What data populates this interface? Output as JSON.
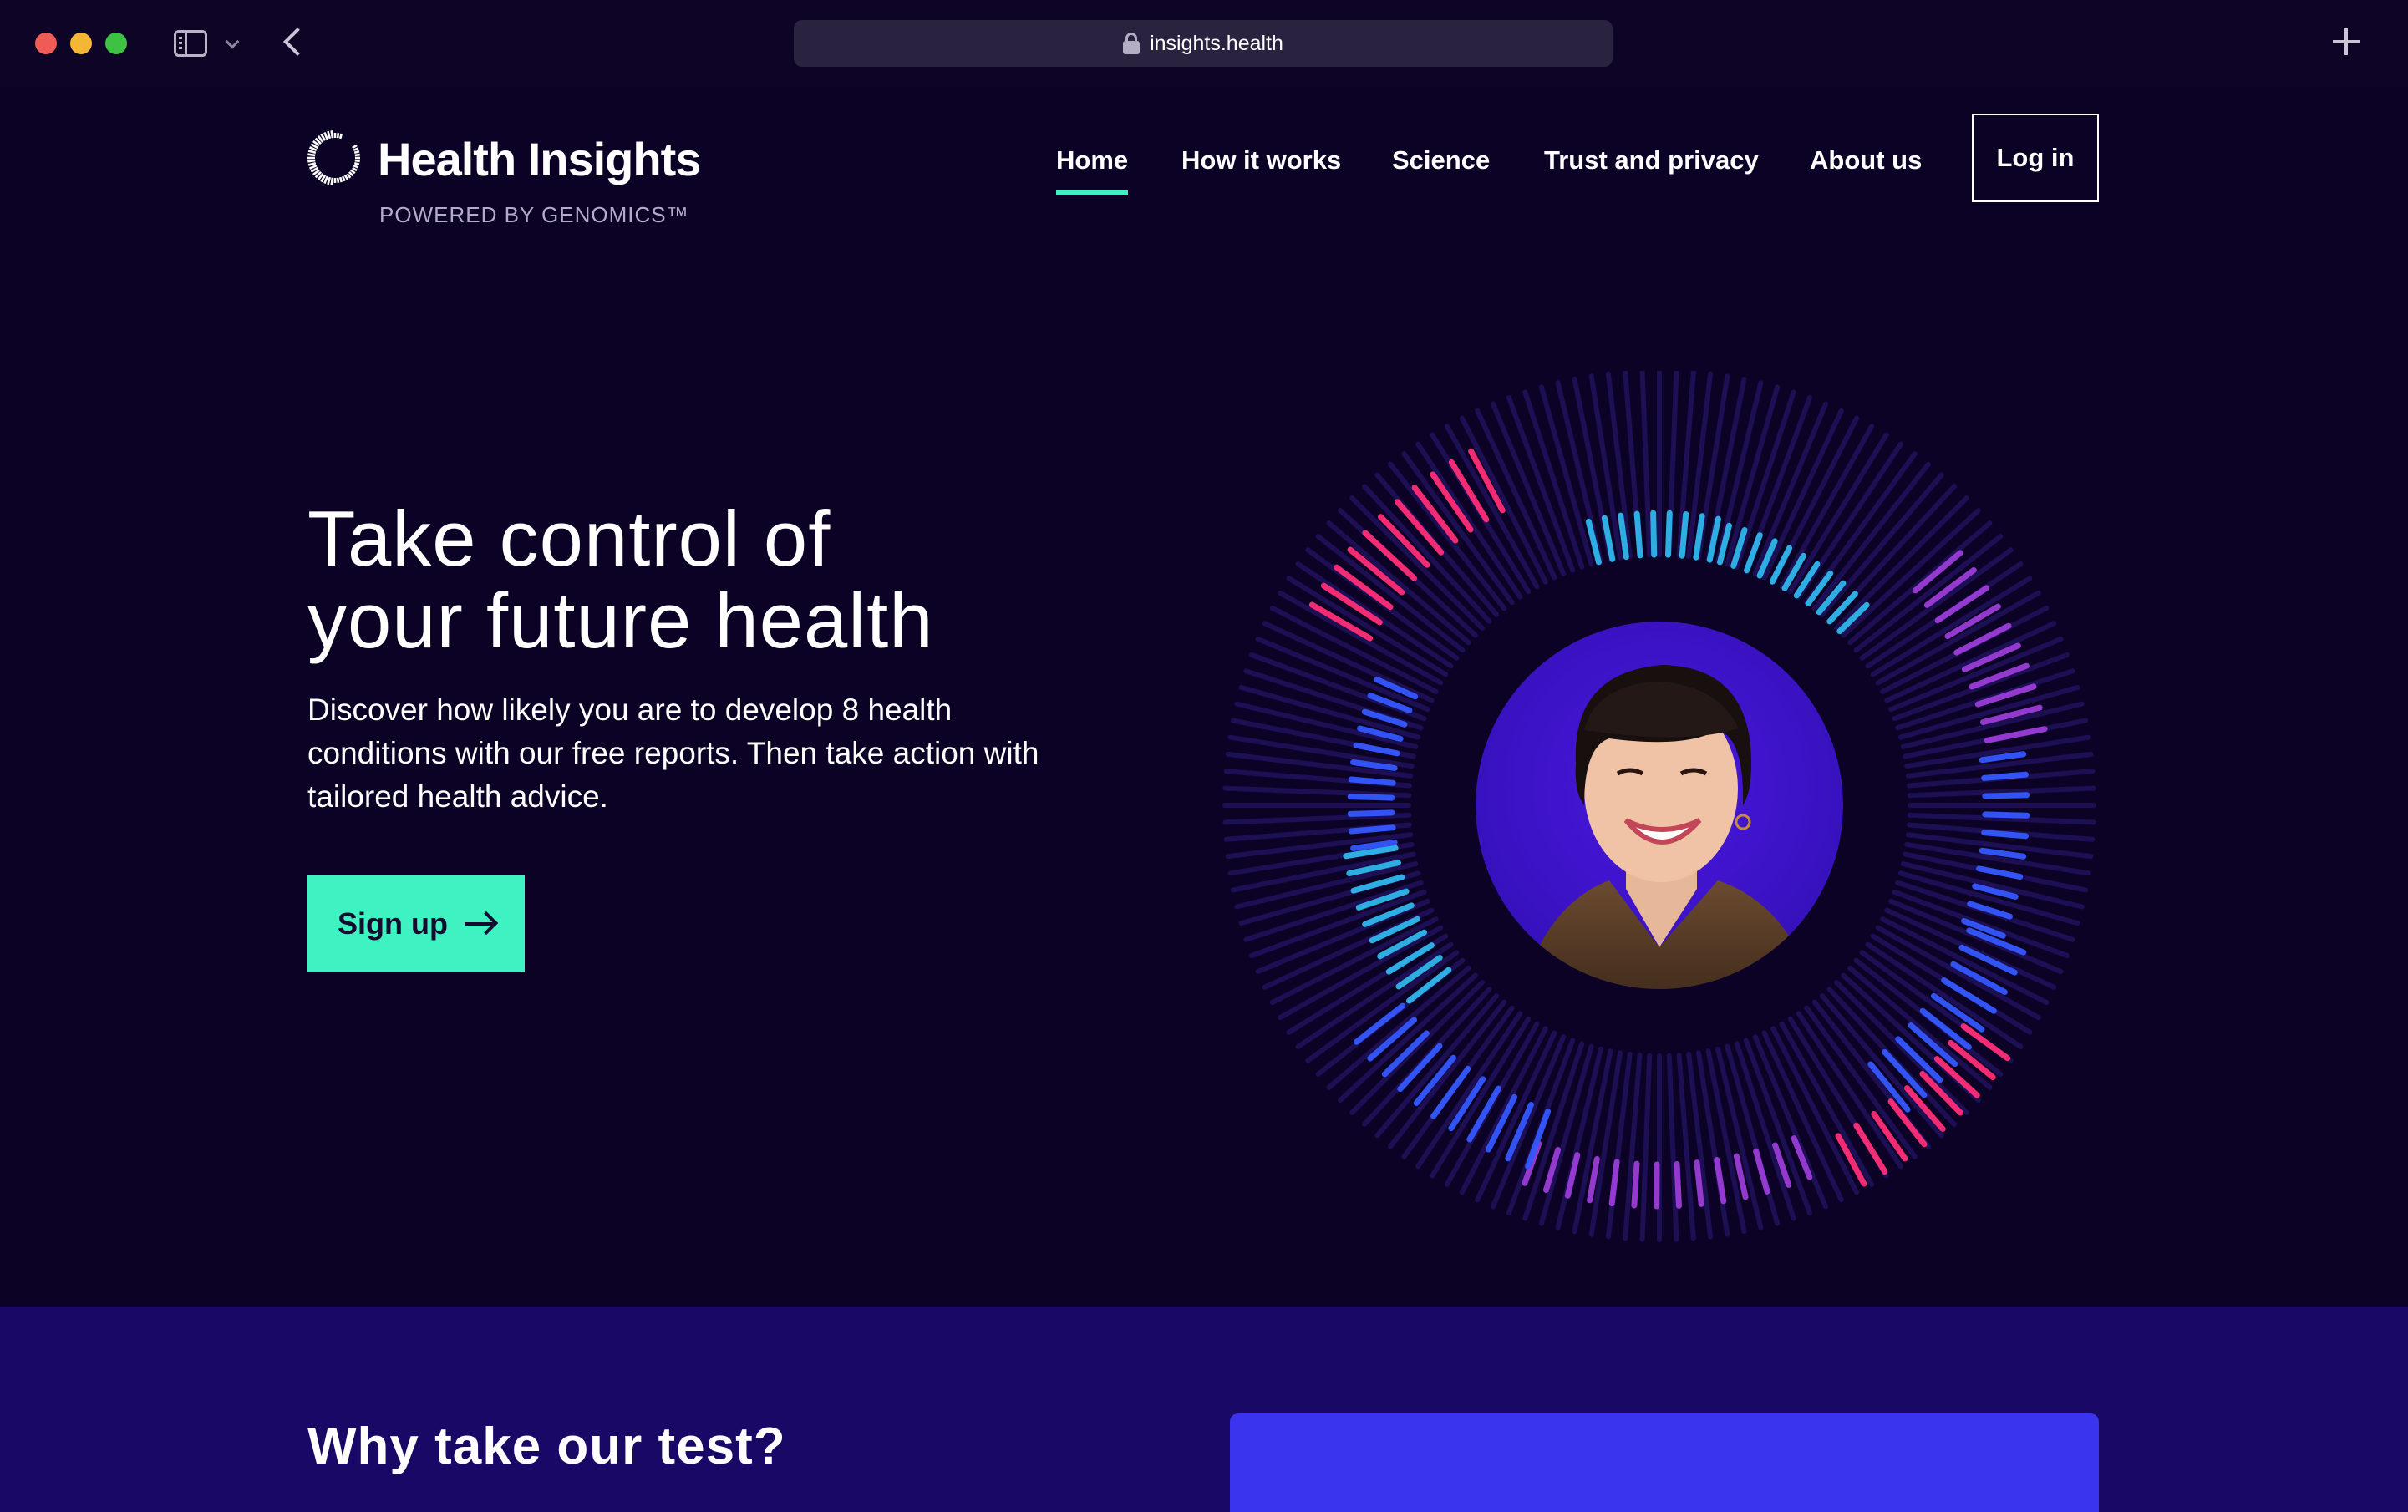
{
  "browser": {
    "url": "insights.health"
  },
  "brand": {
    "name": "Health Insights",
    "tagline": "POWERED BY GENOMICS™"
  },
  "nav": {
    "items": [
      {
        "label": "Home",
        "active": true
      },
      {
        "label": "How it works"
      },
      {
        "label": "Science"
      },
      {
        "label": "Trust and privacy"
      },
      {
        "label": "About us"
      }
    ],
    "login_label": "Log in"
  },
  "hero": {
    "title_line1": "Take control of",
    "title_line2": "your future health",
    "subtitle": "Discover how likely you are to develop 8 health conditions with our free reports. Then take action with tailored health advice.",
    "cta_label": "Sign up"
  },
  "section": {
    "title": "Why take our test?"
  },
  "colors": {
    "background": "#0c0226",
    "accent": "#3ef2c2",
    "section_bg": "#1a0866",
    "card": "#3a34ee",
    "ring_pink": "#ff2e78",
    "ring_cyan": "#2fb7ec",
    "ring_blue": "#3558ff",
    "ring_violet": "#9b3cd8"
  },
  "icons": [
    "lock-icon",
    "sidebar-icon",
    "chevron-down-icon",
    "back-icon",
    "plus-icon",
    "arrow-right-icon",
    "logo-ring-icon"
  ]
}
